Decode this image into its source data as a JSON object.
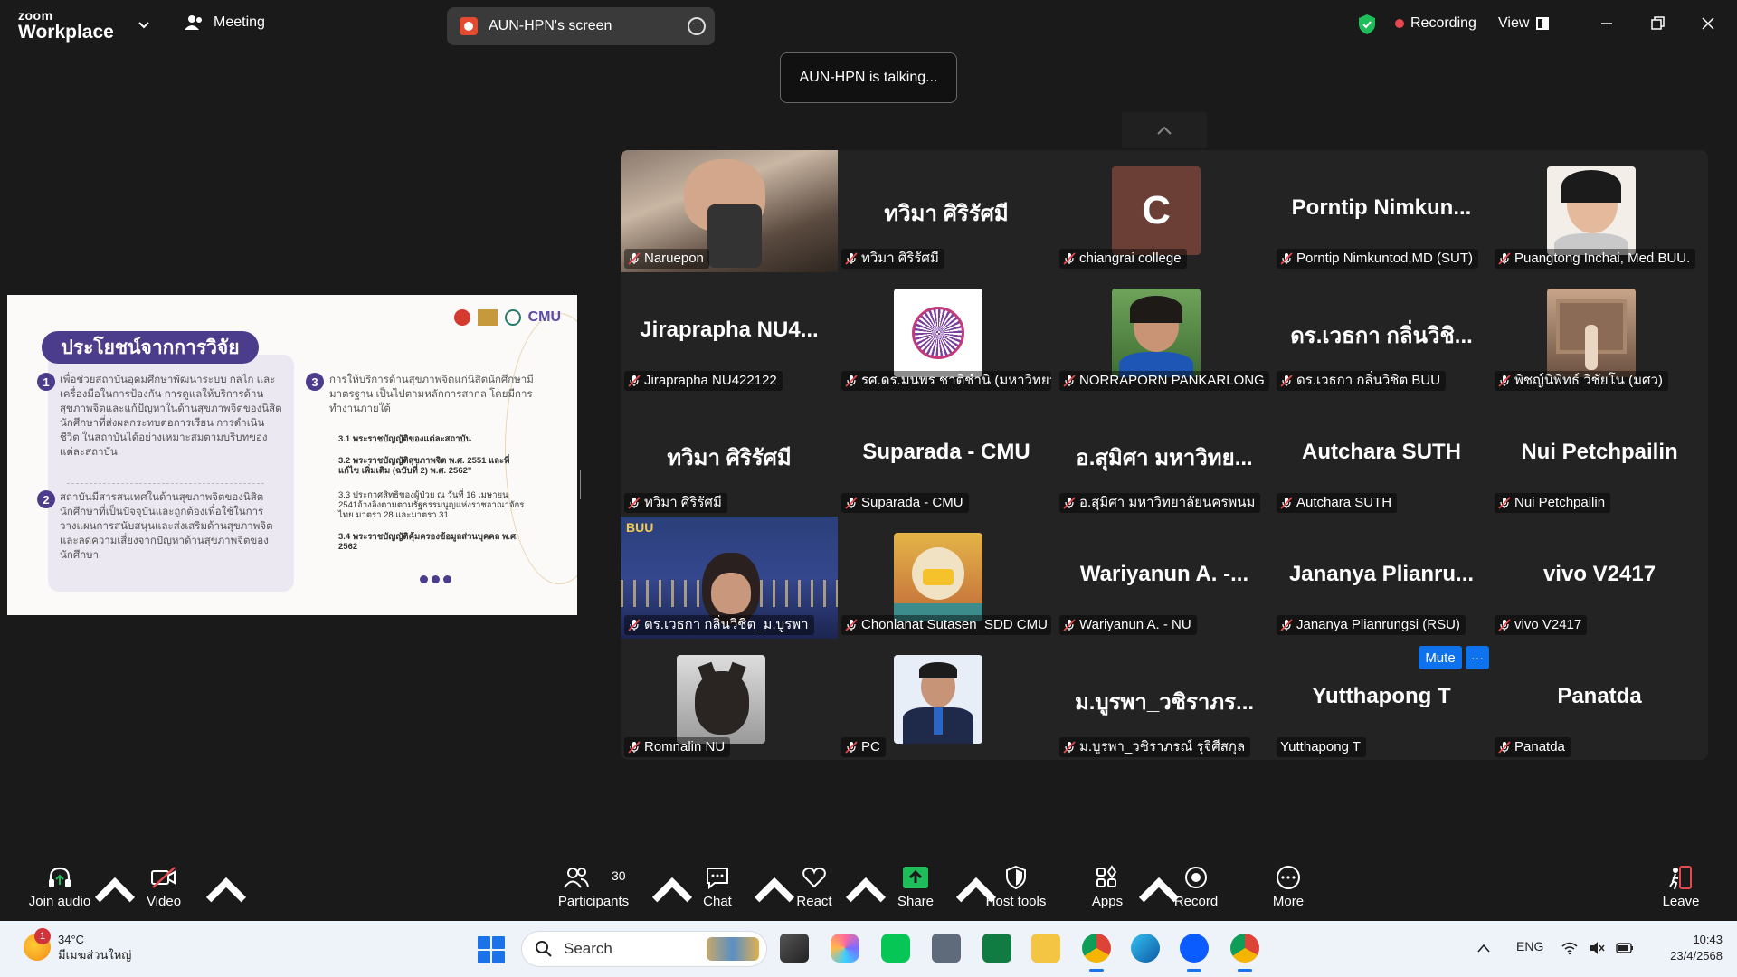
{
  "app": {
    "logo_small": "zoom",
    "logo_big": "Workplace"
  },
  "header": {
    "meeting_label": "Meeting",
    "share_label": "AUN-HPN's screen",
    "recording_label": "Recording",
    "view_label": "View",
    "talking_label": "AUN-HPN is talking..."
  },
  "slide": {
    "title": "ประโยชน์จากการวิจัย",
    "logo_text": "CMU",
    "p1": "เพื่อช่วยสถาบันอุดมศึกษาพัฒนาระบบ กลไก และเครื่องมือในการป้องกัน การดูแลให้บริการด้านสุขภาพจิตและแก้ปัญหาในด้านสุขภาพจิตของนิสิตนักศึกษาที่ส่งผลกระทบต่อการเรียน การดำเนินชีวิต ในสถาบันได้อย่างเหมาะสมตามบริบทของแต่ละสถาบัน",
    "p2": "สถาบันมีสารสนเทศในด้านสุขภาพจิตของนิสิตนักศึกษาที่เป็นปัจจุบันและถูกต้องเพื่อใช้ในการวางแผนการสนับสนุนและส่งเสริมด้านสุขภาพจิต และลดความเสี่ยงจากปัญหาด้านสุขภาพจิตของนักศึกษา",
    "p3": "การให้บริการด้านสุขภาพจิตแก่นิสิตนักศึกษามีมาตรฐาน เป็นไปตามหลักการสากล โดยมีการทำงานภายใต้",
    "s1": "3.1 พระราชบัญญัติของแต่ละสถาบัน",
    "s2": "3.2 พระราชบัญญัติสุขภาพจิต พ.ศ. 2551 และที่แก้ไข เพิ่มเติม (ฉบับที่ 2) พ.ศ. 2562\"",
    "s3": "3.3 ประกาศสิทธิของผู้ป่วย ณ วันที่ 16 เมษายน 2541อ้างอิงตามตามรัฐธรรมนูญแห่งราชอาณาจักรไทย มาตรา 28 และมาตรา 31",
    "s4": "3.4 พระราชบัญญัติคุ้มครองข้อมูลส่วนบุคคล พ.ศ. 2562"
  },
  "participants": [
    {
      "name": "Naruepon",
      "big": "",
      "kind": "video-man"
    },
    {
      "name": "ทวิมา ศิริรัศมี",
      "big": "ทวิมา ศิริรัศมี",
      "kind": "text"
    },
    {
      "name": "chiangrai college",
      "big": "C",
      "kind": "initial"
    },
    {
      "name": "Porntip Nimkuntod,MD (SUT)",
      "big": "Porntip Nimkun...",
      "kind": "text"
    },
    {
      "name": "Puangtong Inchai, Med.BUU.",
      "big": "",
      "kind": "photo-woman"
    },
    {
      "name": "Jiraprapha NU422122",
      "big": "Jiraprapha NU4...",
      "kind": "text"
    },
    {
      "name": "รศ.ดร.มนพร ชาติชำนิ (มหาวิทยา...",
      "big": "",
      "kind": "logo-uni"
    },
    {
      "name": "NORRAPORN PANKARLONG",
      "big": "",
      "kind": "photo-outdoor"
    },
    {
      "name": "ดร.เวธกา กลิ่นวิชิต BUU",
      "big": "ดร.เวธกา กลิ่นวิชิ...",
      "kind": "text"
    },
    {
      "name": "พิชญ์นิพิทธ์ วิชัยโน (มศว)",
      "big": "",
      "kind": "photo-building"
    },
    {
      "name": "ทวิมา ศิริรัศมี",
      "big": "ทวิมา ศิริรัศมี",
      "kind": "text"
    },
    {
      "name": "Suparada - CMU",
      "big": "Suparada - CMU",
      "kind": "text"
    },
    {
      "name": "อ.สุมิศา มหาวิทยาลัยนครพนม",
      "big": "อ.สุมิศา มหาวิทย...",
      "kind": "text"
    },
    {
      "name": "Autchara SUTH",
      "big": "Autchara SUTH",
      "kind": "text"
    },
    {
      "name": "Nui Petchpailin",
      "big": "Nui Petchpailin",
      "kind": "text"
    },
    {
      "name": "ดร.เวธกา กลิ่นวิชิต_ม.บูรพา",
      "big": "",
      "kind": "video-buu"
    },
    {
      "name": "Chonlanat Sutasen_SDD CMU",
      "big": "",
      "kind": "photo-cartoon"
    },
    {
      "name": "Wariyanun A. - NU",
      "big": "Wariyanun A. -...",
      "kind": "text"
    },
    {
      "name": "Jananya Plianrungsi (RSU)",
      "big": "Jananya Plianru...",
      "kind": "text"
    },
    {
      "name": "vivo V2417",
      "big": "vivo V2417",
      "kind": "text"
    },
    {
      "name": "Romnalin NU",
      "big": "",
      "kind": "photo-cat"
    },
    {
      "name": "PC",
      "big": "",
      "kind": "photo-suit"
    },
    {
      "name": "ม.บูรพา_วชิราภรณ์ รุจิศีสกุล",
      "big": "ม.บูรพา_วชิราภร...",
      "kind": "text"
    },
    {
      "name": "Yutthapong T",
      "big": "Yutthapong T",
      "kind": "text",
      "unmuted": true
    },
    {
      "name": "Panatda",
      "big": "Panatda",
      "kind": "text"
    }
  ],
  "tile_actions": {
    "mute_label": "Mute",
    "more_label": "···"
  },
  "toolbar": {
    "join_audio": "Join audio",
    "video": "Video",
    "participants": "Participants",
    "participants_count": "30",
    "chat": "Chat",
    "react": "React",
    "share": "Share",
    "host_tools": "Host tools",
    "apps": "Apps",
    "record": "Record",
    "more": "More",
    "leave": "Leave"
  },
  "taskbar": {
    "weather_temp": "34°C",
    "weather_desc": "มีเมฆส่วนใหญ่",
    "weather_badge": "1",
    "search_label": "Search",
    "lang": "ENG",
    "time": "10:43",
    "date": "23/4/2568"
  },
  "colors": {
    "zoom_blue": "#0e72ed",
    "record_red": "#e5484d",
    "share_green": "#1fbd5a",
    "slide_purple": "#4b3c8c"
  }
}
